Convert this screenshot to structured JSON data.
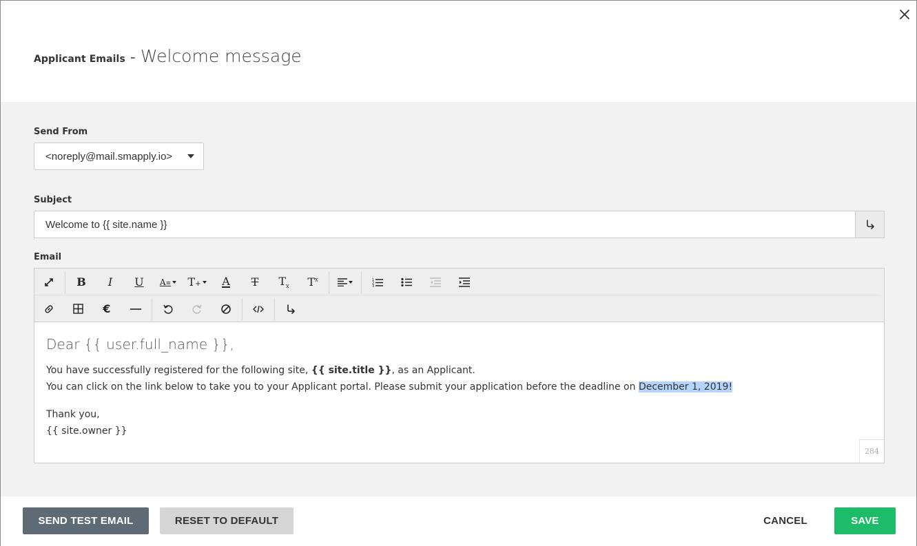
{
  "header": {
    "breadcrumb": "Applicant Emails",
    "separator": "-",
    "title": "Welcome message"
  },
  "form": {
    "send_from": {
      "label": "Send From",
      "selected": "<noreply@mail.smapply.io>"
    },
    "subject": {
      "label": "Subject",
      "value": "Welcome to {{ site.name }}"
    },
    "email": {
      "label": "Email",
      "toolbar_row1": [
        "fullscreen-icon",
        "bold-icon",
        "italic-icon",
        "underline-icon",
        "font-size-icon",
        "text-style-icon",
        "font-color-icon",
        "strikethrough-icon",
        "subscript-icon",
        "superscript-icon",
        "align-icon",
        "ordered-list-icon",
        "unordered-list-icon",
        "outdent-icon",
        "indent-icon"
      ],
      "toolbar_row2": [
        "link-icon",
        "table-icon",
        "special-character-icon",
        "horizontal-rule-icon",
        "undo-icon",
        "redo-icon",
        "clear-format-icon",
        "code-view-icon",
        "insert-variable-icon"
      ],
      "body": {
        "greeting": "Dear {{ user.full_name }},",
        "line1_prefix": "You have successfully registered for the following site, ",
        "line1_bold": "{{ site.title }}",
        "line1_suffix": ", as an Applicant.",
        "line2_prefix": "You can click on the link below to take you to your Applicant portal. Please submit your application before the deadline on ",
        "line2_highlight": "December 1, 2019!",
        "thanks": "Thank you,",
        "signature": "{{ site.owner }}"
      },
      "char_count": "284"
    }
  },
  "footer": {
    "send_test": "SEND TEST EMAIL",
    "reset": "RESET TO DEFAULT",
    "cancel": "CANCEL",
    "save": "SAVE"
  },
  "colors": {
    "save": "#1dbc69",
    "send_test": "#5f6b74",
    "reset": "#d5d5d5",
    "highlight": "#b5d5ff"
  }
}
